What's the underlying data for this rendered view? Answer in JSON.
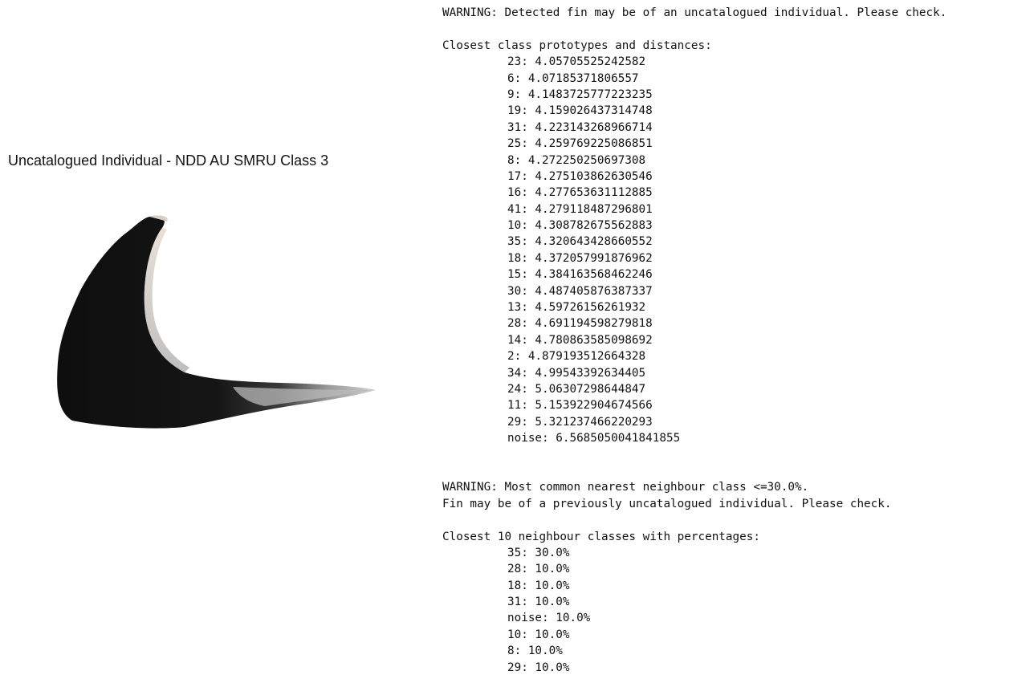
{
  "figure": {
    "title": "Uncatalogued Individual - NDD AU SMRU Class 3"
  },
  "console": {
    "warning1": "WARNING: Detected fin may be of an uncatalogued individual. Please check.",
    "prototypes_header": "Closest class prototypes and distances:",
    "prototypes": [
      {
        "text": "23: 4.05705525242582"
      },
      {
        "text": "6: 4.07185371806557"
      },
      {
        "text": "9: 4.1483725777223235"
      },
      {
        "text": "19: 4.159026437314748"
      },
      {
        "text": "31: 4.223143268966714"
      },
      {
        "text": "25: 4.259769225086851"
      },
      {
        "text": "8: 4.272250250697308"
      },
      {
        "text": "17: 4.275103862630546"
      },
      {
        "text": "16: 4.277653631112885"
      },
      {
        "text": "41: 4.279118487296801"
      },
      {
        "text": "10: 4.308782675562883"
      },
      {
        "text": "35: 4.320643428660552"
      },
      {
        "text": "18: 4.372057991876962"
      },
      {
        "text": "15: 4.384163568462246"
      },
      {
        "text": "30: 4.487405876387337"
      },
      {
        "text": "13: 4.59726156261932"
      },
      {
        "text": "28: 4.691194598279818"
      },
      {
        "text": "14: 4.780863585098692"
      },
      {
        "text": "2: 4.879193512664328"
      },
      {
        "text": "34: 4.99543392634405"
      },
      {
        "text": "24: 5.06307298644847"
      },
      {
        "text": "11: 5.153922904674566"
      },
      {
        "text": "29: 5.321237466220293"
      },
      {
        "text": "noise: 6.5685050041841855"
      }
    ],
    "warning2_line1": "WARNING: Most common nearest neighbour class <=30.0%.",
    "warning2_line2": "Fin may be of a previously uncatalogued individual. Please check.",
    "neighbours_header": "Closest 10 neighbour classes with percentages:",
    "neighbours": [
      {
        "text": "35: 30.0%"
      },
      {
        "text": "28: 10.0%"
      },
      {
        "text": "18: 10.0%"
      },
      {
        "text": "31: 10.0%"
      },
      {
        "text": "noise: 10.0%"
      },
      {
        "text": "10: 10.0%"
      },
      {
        "text": "8: 10.0%"
      },
      {
        "text": "29: 10.0%"
      }
    ]
  }
}
